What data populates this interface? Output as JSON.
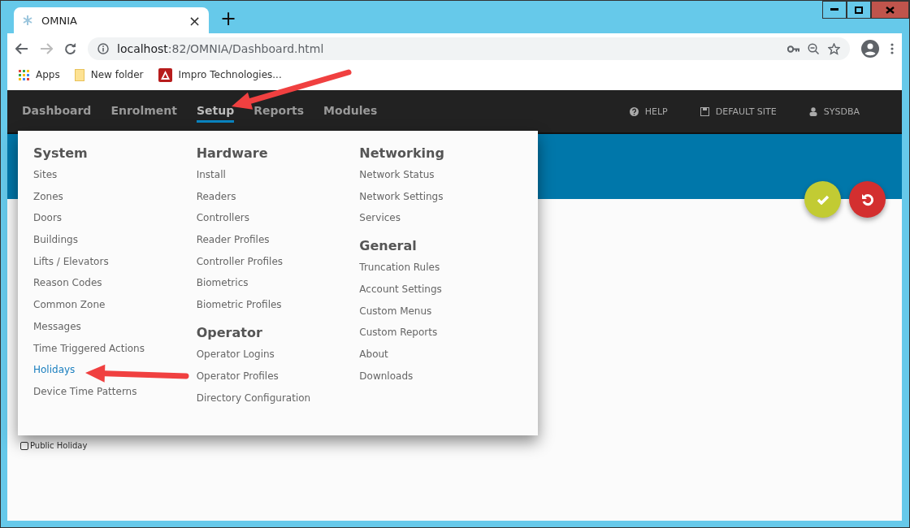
{
  "browser": {
    "tab": {
      "title": "OMNIA",
      "close": "×"
    },
    "new_tab": "+",
    "address": {
      "host": "localhost",
      "path": ":82/OMNIA/Dashboard.html"
    },
    "bookmarks": [
      {
        "label": "Apps",
        "kind": "apps"
      },
      {
        "label": "New folder",
        "kind": "folder"
      },
      {
        "label": "Impro Technologies...",
        "kind": "site"
      }
    ]
  },
  "nav": {
    "items": [
      {
        "label": "Dashboard",
        "selected": false
      },
      {
        "label": "Enrolment",
        "selected": false
      },
      {
        "label": "Setup",
        "selected": true
      },
      {
        "label": "Reports",
        "selected": false
      },
      {
        "label": "Modules",
        "selected": false
      }
    ],
    "right": [
      {
        "label": "HELP",
        "kind": "help"
      },
      {
        "label": "DEFAULT SITE",
        "kind": "site"
      },
      {
        "label": "SYSDBA",
        "kind": "user"
      }
    ]
  },
  "menu": {
    "columns": [
      {
        "sections": [
          {
            "title": "System",
            "items": [
              {
                "label": "Sites",
                "selected": false
              },
              {
                "label": "Zones",
                "selected": false
              },
              {
                "label": "Doors",
                "selected": false
              },
              {
                "label": "Buildings",
                "selected": false
              },
              {
                "label": "Lifts / Elevators",
                "selected": false
              },
              {
                "label": "Reason Codes",
                "selected": false
              },
              {
                "label": "Common Zone",
                "selected": false
              },
              {
                "label": "Messages",
                "selected": false
              },
              {
                "label": "Time Triggered Actions",
                "selected": false
              },
              {
                "label": "Holidays",
                "selected": true
              },
              {
                "label": "Device Time Patterns",
                "selected": false
              }
            ]
          }
        ]
      },
      {
        "sections": [
          {
            "title": "Hardware",
            "items": [
              {
                "label": "Install",
                "selected": false
              },
              {
                "label": "Readers",
                "selected": false
              },
              {
                "label": "Controllers",
                "selected": false
              },
              {
                "label": "Reader Profiles",
                "selected": false
              },
              {
                "label": "Controller Profiles",
                "selected": false
              },
              {
                "label": "Biometrics",
                "selected": false
              },
              {
                "label": "Biometric Profiles",
                "selected": false
              }
            ]
          },
          {
            "title": "Operator",
            "items": [
              {
                "label": "Operator Logins",
                "selected": false
              },
              {
                "label": "Operator Profiles",
                "selected": false
              },
              {
                "label": "Directory Configuration",
                "selected": false
              }
            ]
          }
        ]
      },
      {
        "sections": [
          {
            "title": "Networking",
            "items": [
              {
                "label": "Network Status",
                "selected": false
              },
              {
                "label": "Network Settings",
                "selected": false
              },
              {
                "label": "Services",
                "selected": false
              }
            ]
          },
          {
            "title": "General",
            "items": [
              {
                "label": "Truncation Rules",
                "selected": false
              },
              {
                "label": "Account Settings",
                "selected": false
              },
              {
                "label": "Custom Menus",
                "selected": false
              },
              {
                "label": "Custom Reports",
                "selected": false
              },
              {
                "label": "About",
                "selected": false
              },
              {
                "label": "Downloads",
                "selected": false
              }
            ]
          }
        ]
      }
    ]
  },
  "checkboxes": [
    {
      "label": "Public Holiday",
      "checked": false
    }
  ]
}
